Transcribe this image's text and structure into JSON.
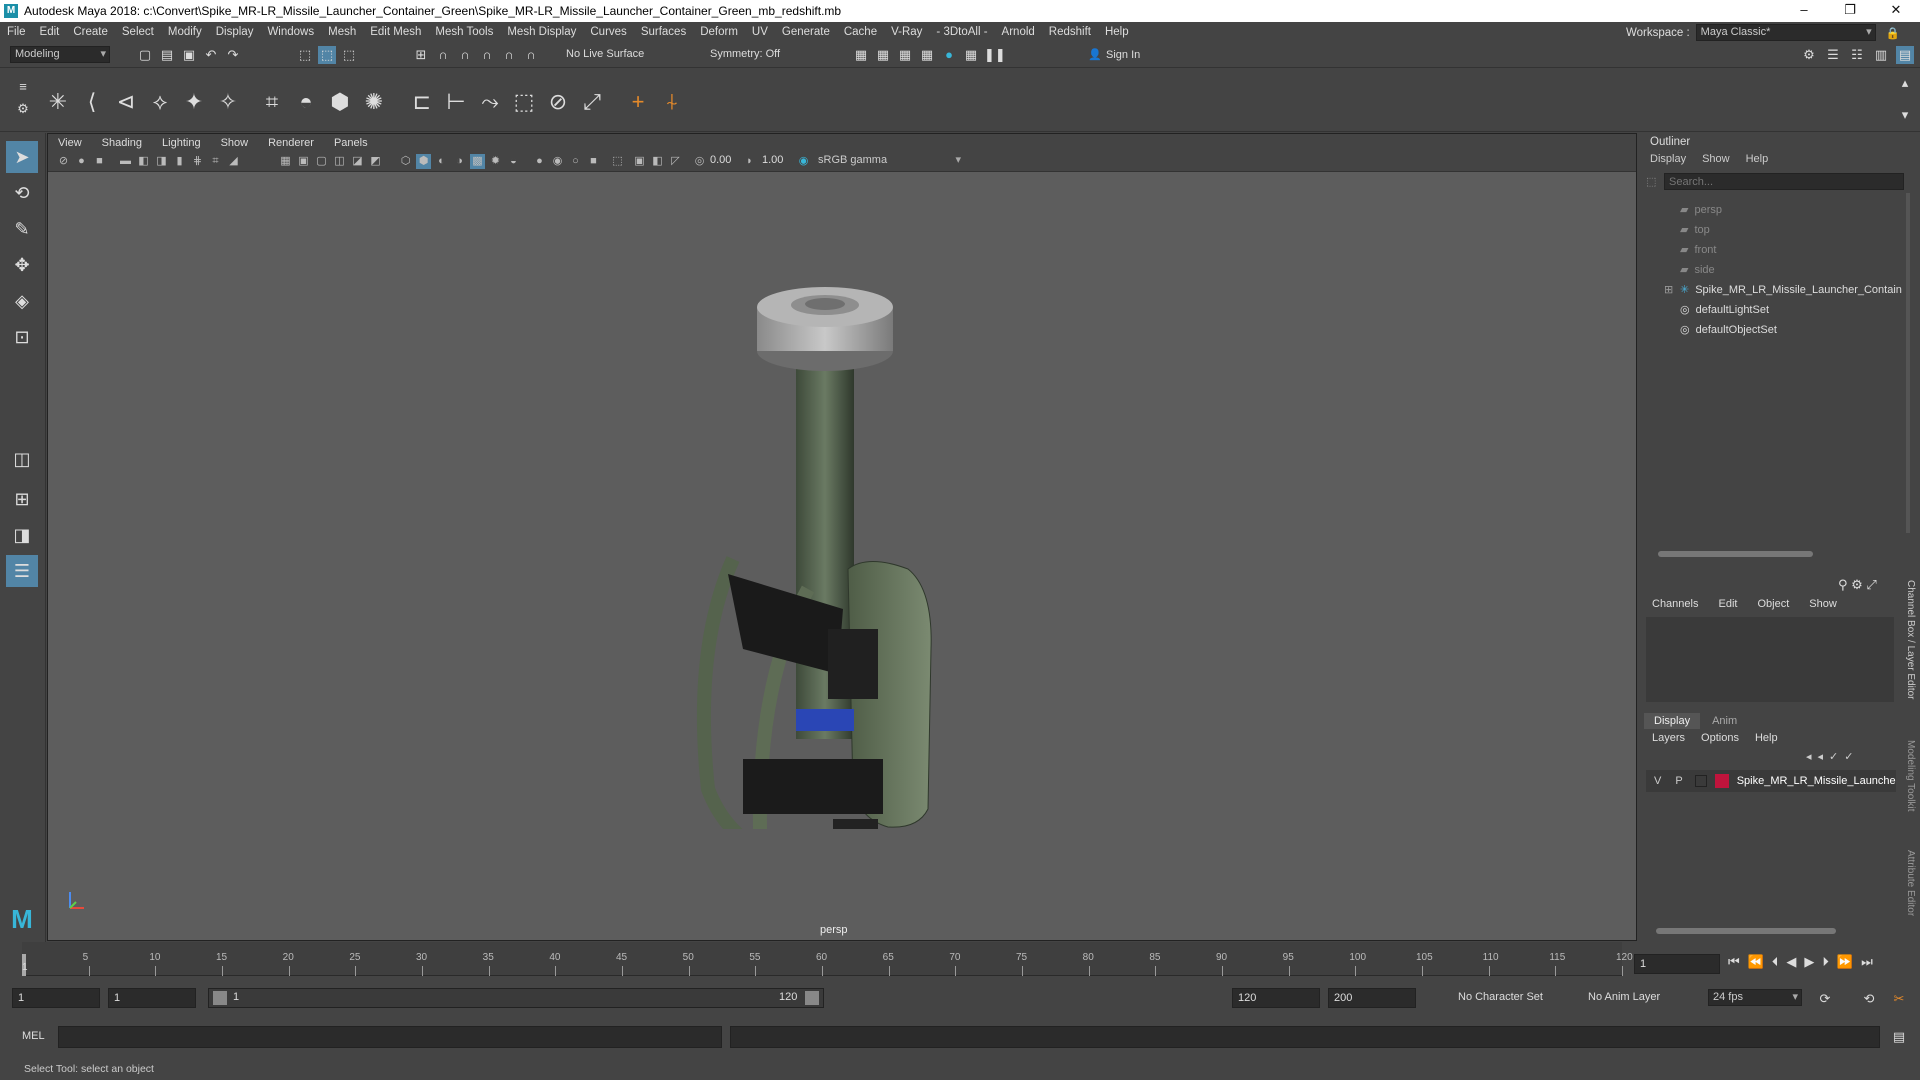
{
  "app": {
    "title": "Autodesk Maya 2018: c:\\Convert\\Spike_MR-LR_Missile_Launcher_Container_Green\\Spike_MR-LR_Missile_Launcher_Container_Green_mb_redshift.mb"
  },
  "menus": [
    "File",
    "Edit",
    "Create",
    "Select",
    "Modify",
    "Display",
    "Windows",
    "Mesh",
    "Edit Mesh",
    "Mesh Tools",
    "Mesh Display",
    "Curves",
    "Surfaces",
    "Deform",
    "UV",
    "Generate",
    "Cache",
    "V-Ray",
    "- 3DtoAll -",
    "Arnold",
    "Redshift",
    "Help"
  ],
  "workspace": {
    "label": "Workspace :",
    "value": "Maya Classic*"
  },
  "status": {
    "mode": "Modeling",
    "live_surface": "No Live Surface",
    "symmetry": "Symmetry: Off",
    "sign_in": "Sign In"
  },
  "viewport": {
    "menus": [
      "View",
      "Shading",
      "Lighting",
      "Show",
      "Renderer",
      "Panels"
    ],
    "field1": "0.00",
    "field2": "1.00",
    "colorspace": "sRGB gamma",
    "camera_label": "persp"
  },
  "outliner": {
    "title": "Outliner",
    "menus": [
      "Display",
      "Show",
      "Help"
    ],
    "search_placeholder": "Search...",
    "items": [
      "persp",
      "top",
      "front",
      "side",
      "Spike_MR_LR_Missile_Launcher_Contain",
      "defaultLightSet",
      "defaultObjectSet"
    ]
  },
  "channelbox": {
    "menus": [
      "Channels",
      "Edit",
      "Object",
      "Show"
    ]
  },
  "layers": {
    "tabs": [
      "Display",
      "Anim"
    ],
    "menus": [
      "Layers",
      "Options",
      "Help"
    ],
    "row": {
      "v": "V",
      "p": "P",
      "name": "Spike_MR_LR_Missile_Launche"
    }
  },
  "side_tabs": [
    "Channel Box / Layer Editor",
    "Modeling Toolkit",
    "Attribute Editor"
  ],
  "timeline": {
    "ticks": [
      "5",
      "10",
      "15",
      "20",
      "25",
      "30",
      "35",
      "40",
      "45",
      "50",
      "55",
      "60",
      "65",
      "70",
      "75",
      "80",
      "85",
      "90",
      "95",
      "100",
      "105",
      "110",
      "115",
      "120"
    ],
    "start_marker": "1",
    "current_frame": "1"
  },
  "range": {
    "start": "1",
    "playback_start": "1",
    "slider_start": "1",
    "slider_end": "120",
    "playback_end": "120",
    "end": "200",
    "character_set": "No Character Set",
    "anim_layer": "No Anim Layer",
    "fps": "24 fps"
  },
  "cmdline": {
    "label": "MEL"
  },
  "helpline": {
    "text": "Select Tool: select an object"
  }
}
